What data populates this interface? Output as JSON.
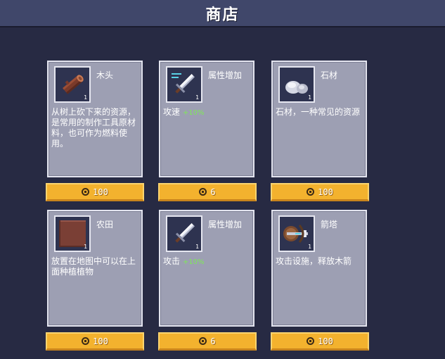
{
  "header": {
    "title": "商店"
  },
  "items": [
    {
      "name": "木头",
      "quantity": "1",
      "icon": "log-icon",
      "description": "从树上砍下来的资源，是常用的制作工具原材料，也可作为燃料使用。",
      "bonus": "",
      "price": "100"
    },
    {
      "name": "属性增加",
      "quantity": "1",
      "icon": "sword-speed-icon",
      "description": "攻速",
      "bonus": "+10%",
      "price": "6"
    },
    {
      "name": "石材",
      "quantity": "1",
      "icon": "stone-icon",
      "description": "石材，一种常见的资源",
      "bonus": "",
      "price": "100"
    },
    {
      "name": "农田",
      "quantity": "1",
      "icon": "farmland-icon",
      "description": "放置在地图中可以在上面种植植物",
      "bonus": "",
      "price": "100"
    },
    {
      "name": "属性增加",
      "quantity": "1",
      "icon": "sword-icon",
      "description": "攻击",
      "bonus": "+10%",
      "price": "6"
    },
    {
      "name": "箭塔",
      "quantity": "1",
      "icon": "crossbow-icon",
      "description": "攻击设施，释放木箭",
      "bonus": "",
      "price": "100"
    }
  ],
  "colors": {
    "background": "#272a43",
    "card": "#9d9fb3",
    "button": "#f3b22e",
    "bonus": "#7ee857"
  }
}
